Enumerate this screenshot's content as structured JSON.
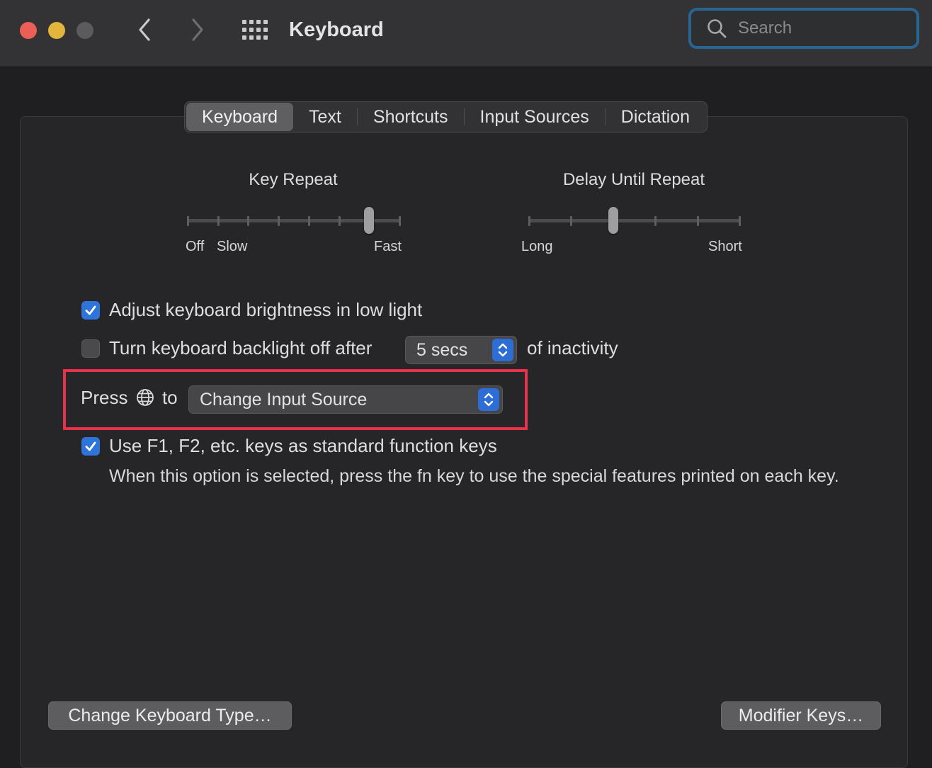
{
  "window": {
    "title": "Keyboard",
    "search_placeholder": "Search"
  },
  "tabs": [
    {
      "label": "Keyboard",
      "active": true
    },
    {
      "label": "Text"
    },
    {
      "label": "Shortcuts"
    },
    {
      "label": "Input Sources"
    },
    {
      "label": "Dictation"
    }
  ],
  "key_repeat": {
    "title": "Key Repeat",
    "label_off": "Off",
    "label_slow": "Slow",
    "label_fast": "Fast",
    "value_step": 6,
    "steps": 8
  },
  "delay_until_repeat": {
    "title": "Delay Until Repeat",
    "label_long": "Long",
    "label_short": "Short",
    "value_step": 2,
    "steps": 6
  },
  "options": {
    "adjust_brightness": {
      "label": "Adjust keyboard brightness in low light",
      "checked": true
    },
    "backlight_off": {
      "label": "Turn keyboard backlight off after",
      "checked": false,
      "value": "5 secs",
      "suffix": "of inactivity"
    },
    "press_globe": {
      "prefix": "Press",
      "suffix": "to",
      "value": "Change Input Source"
    },
    "fn_keys": {
      "label": "Use F1, F2, etc. keys as standard function keys",
      "checked": true,
      "description": "When this option is selected, press the fn key to use the special features printed on each key."
    }
  },
  "buttons": {
    "change_type": "Change Keyboard Type…",
    "modifier_keys": "Modifier Keys…"
  },
  "colors": {
    "accent": "#2f74d8",
    "highlight": "#e8314a",
    "close": "#ec5f57",
    "minimize": "#e2b53b"
  }
}
